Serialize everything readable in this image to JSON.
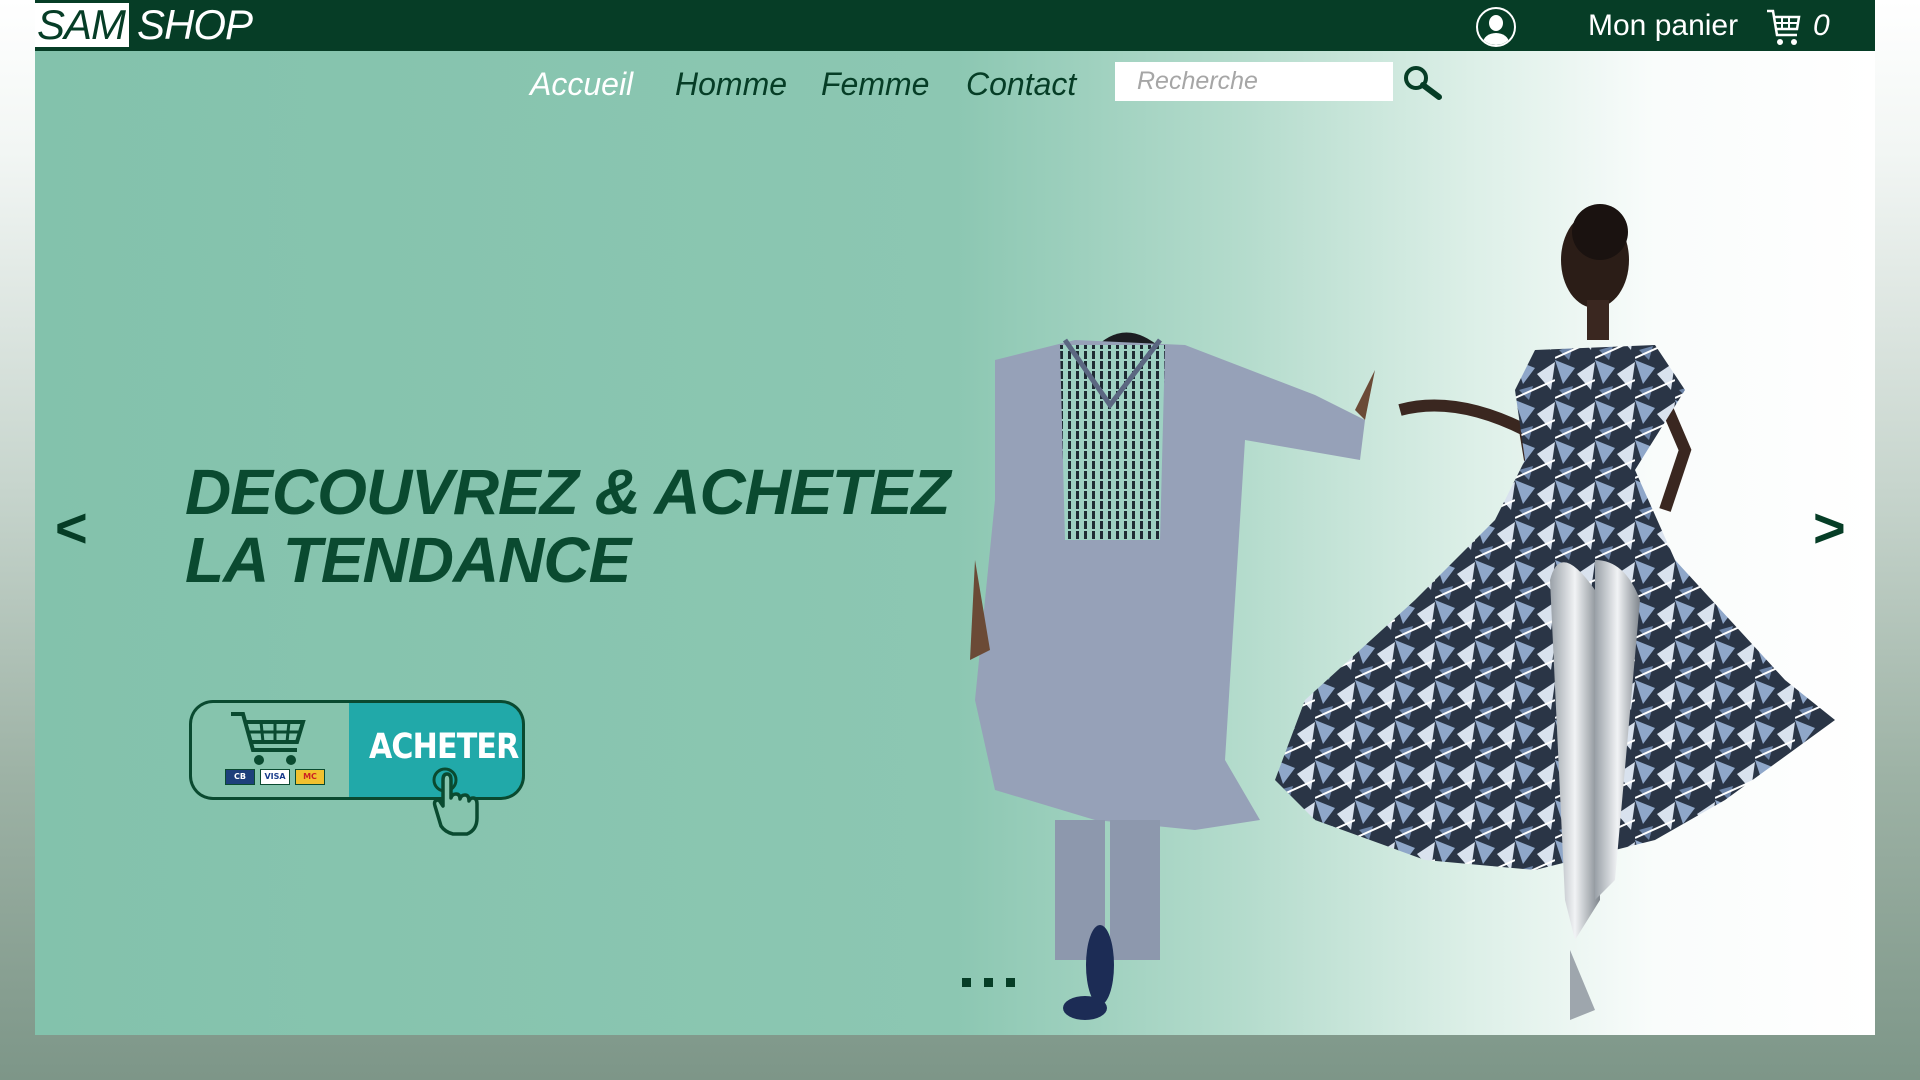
{
  "header": {
    "logo_sam": "SAM",
    "logo_shop": "SHOP",
    "user_icon": "user-icon",
    "cart_label": "Mon panier",
    "cart_icon": "shopping-cart-icon",
    "cart_count": "0"
  },
  "nav": {
    "items": [
      {
        "label": "Accueil",
        "active": true
      },
      {
        "label": "Homme",
        "active": false
      },
      {
        "label": "Femme",
        "active": false
      },
      {
        "label": "Contact",
        "active": false
      }
    ],
    "search": {
      "placeholder": "Recherche",
      "value": "",
      "icon": "search-icon"
    }
  },
  "hero": {
    "title_line1": "DECOUVREZ & ACHETEZ",
    "title_line2": "LA TENDANCE",
    "buy_button_label": "ACHETER",
    "payment_cards": [
      "CB",
      "VISA",
      "MC"
    ],
    "prev_arrow": "<",
    "next_arrow": ">",
    "slide_count": 3,
    "active_slide": 1,
    "images": [
      "man-in-grey-boubou",
      "woman-in-print-dress"
    ]
  },
  "colors": {
    "brand_dark_green": "#063d26",
    "hero_mint": "#86c4ad",
    "button_teal": "#21a9a9",
    "white": "#ffffff"
  }
}
